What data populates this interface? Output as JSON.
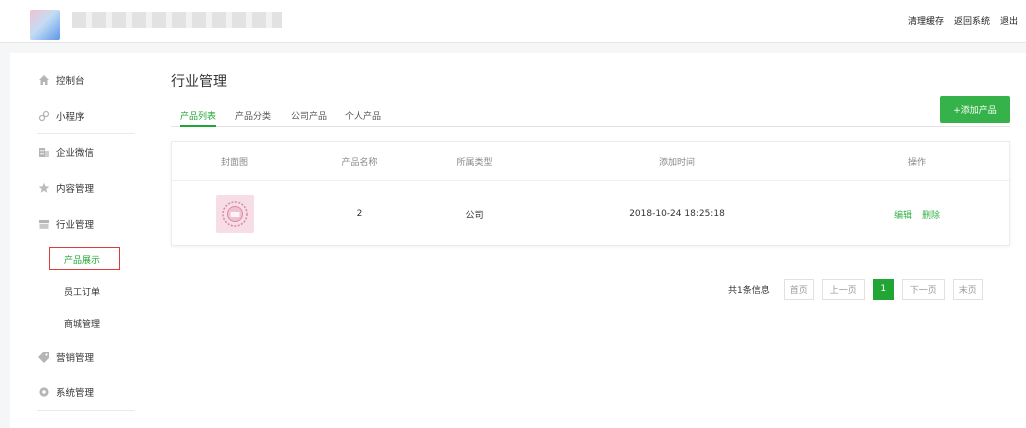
{
  "header": {
    "links": [
      "清理缓存",
      "返回系统",
      "退出"
    ]
  },
  "sidebar": {
    "items": [
      {
        "label": "控制台",
        "icon": "home-icon"
      },
      {
        "label": "小程序",
        "icon": "miniprogram-icon"
      },
      {
        "label": "企业微信",
        "icon": "building-icon"
      },
      {
        "label": "内容管理",
        "icon": "star-icon"
      },
      {
        "label": "行业管理",
        "icon": "archive-icon"
      },
      {
        "label": "营销管理",
        "icon": "tag-icon"
      },
      {
        "label": "系统管理",
        "icon": "gear-icon"
      }
    ],
    "subitems": [
      "产品展示",
      "员工订单",
      "商城管理"
    ],
    "active_subitem": "产品展示"
  },
  "main": {
    "title": "行业管理",
    "tabs": [
      "产品列表",
      "产品分类",
      "公司产品",
      "个人产品"
    ],
    "active_tab": "产品列表",
    "add_button": "+添加产品",
    "table": {
      "columns": [
        "封面图",
        "产品名称",
        "所属类型",
        "添加时间",
        "操作"
      ],
      "rows": [
        {
          "name": "2",
          "type": "公司",
          "time": "2018-10-24 18:25:18",
          "actions": [
            "编辑",
            "删除"
          ]
        }
      ]
    },
    "pagination": {
      "total": "共1条信息",
      "first": "首页",
      "prev": "上一页",
      "current": "1",
      "next": "下一页",
      "last": "末页"
    }
  },
  "colors": {
    "accent": "#36b24a",
    "active_text": "#21a635",
    "highlight_box": "#e03b3b"
  }
}
